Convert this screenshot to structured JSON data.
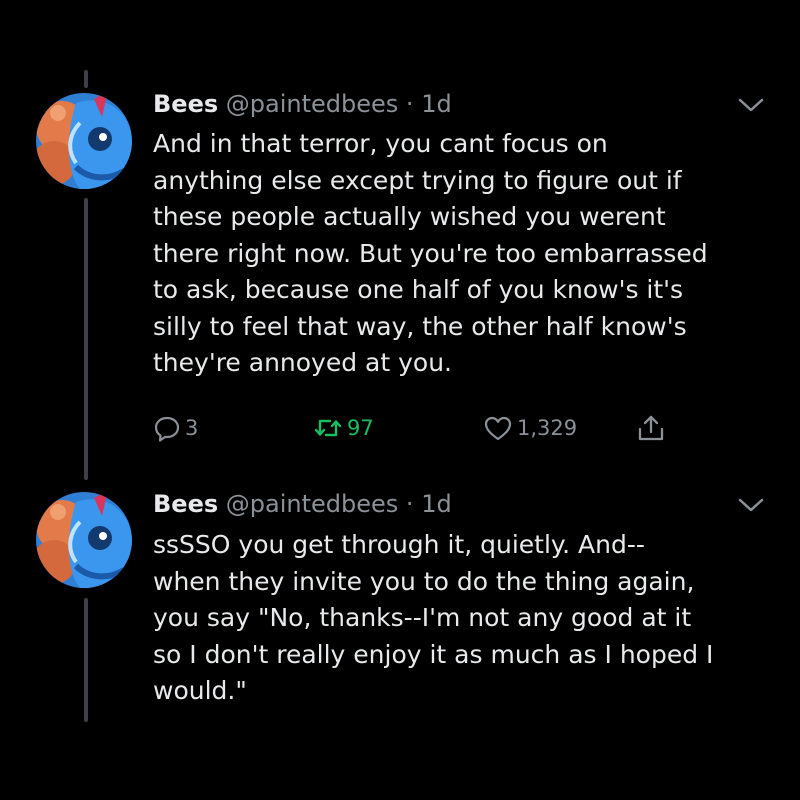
{
  "tweets": [
    {
      "display_name": "Bees",
      "handle": "@paintedbees",
      "separator": "·",
      "time": "1d",
      "text_lines": [
        "And in that terror, you cant focus on",
        "anything else except trying to figure out if",
        "these people actually wished you werent",
        "there right now. But you're too embarrassed",
        "to ask, because one half of you know's it's",
        "silly to feel that way, the other half know's",
        "they're annoyed at you."
      ],
      "replies": "3",
      "retweets": "97",
      "likes": "1,329"
    },
    {
      "display_name": "Bees",
      "handle": "@paintedbees",
      "separator": "·",
      "time": "1d",
      "text_lines": [
        "ssSSO you get through it, quietly. And--",
        "when they invite you to do the thing again,",
        "you say \"No, thanks--I'm not any good at it",
        "so I don't really enjoy it as much as I hoped I",
        "would.\""
      ]
    }
  ],
  "icons": {
    "avatar": "avatar-image",
    "more": "chevron-down-icon",
    "reply": "reply-icon",
    "retweet": "retweet-icon",
    "like": "heart-icon",
    "share": "share-icon"
  },
  "colors": {
    "background": "#000000",
    "text": "#e7e9ea",
    "secondary": "#8b9199",
    "retweet_active": "#17bf63",
    "thread_line": "#3d4147"
  }
}
